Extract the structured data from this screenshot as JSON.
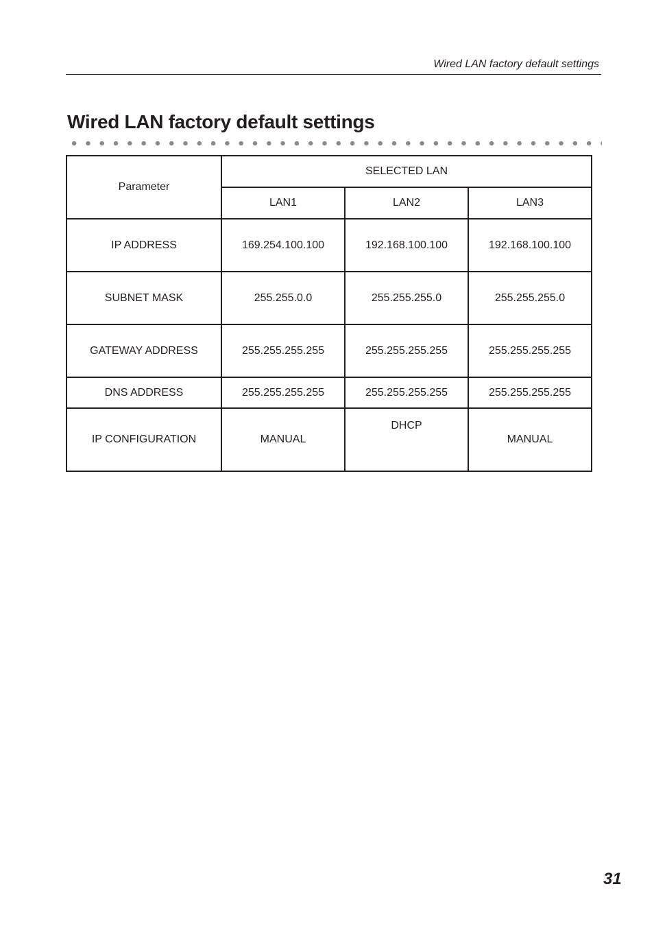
{
  "running_header": "Wired LAN factory default settings",
  "page_title": "Wired LAN factory default settings",
  "table": {
    "param_header": "Parameter",
    "group_header": "SELECTED LAN",
    "columns": [
      "LAN1",
      "LAN2",
      "LAN3"
    ],
    "rows": [
      {
        "parameter": "IP ADDRESS",
        "values": [
          "169.254.100.100",
          "192.168.100.100",
          "192.168.100.100"
        ]
      },
      {
        "parameter": "SUBNET MASK",
        "values": [
          "255.255.0.0",
          "255.255.255.0",
          "255.255.255.0"
        ]
      },
      {
        "parameter": "GATEWAY ADDRESS",
        "values": [
          "255.255.255.255",
          "255.255.255.255",
          "255.255.255.255"
        ]
      },
      {
        "parameter": "DNS ADDRESS",
        "values": [
          "255.255.255.255",
          "255.255.255.255",
          "255.255.255.255"
        ]
      },
      {
        "parameter": "IP CONFIGURATION",
        "values": [
          "MANUAL",
          "DHCP",
          "MANUAL"
        ]
      }
    ]
  },
  "page_number": "31"
}
